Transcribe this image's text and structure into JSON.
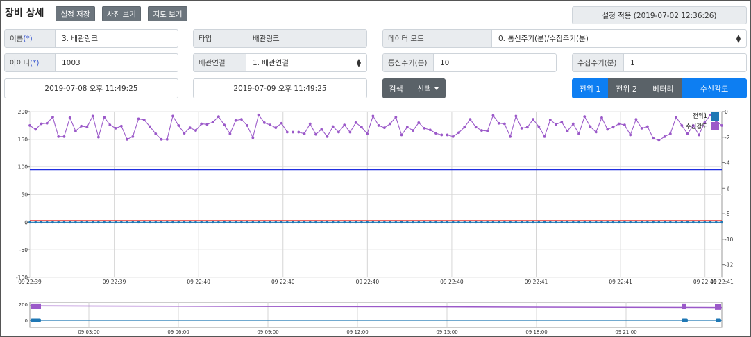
{
  "header": {
    "title": "장비 상세",
    "save_label": "설정 저장",
    "photo_label": "사진 보기",
    "map_label": "지도 보기",
    "apply_label": "설정 적용 (2019-07-02 12:36:26)"
  },
  "form": {
    "name_label": "이름",
    "name_required": "(*)",
    "name_value": "3. 배관링크",
    "type_label": "타입",
    "type_value": "배관링크",
    "mode_label": "데이터 모드",
    "mode_value": "0. 통신주기(분)/수집주기(분)",
    "id_label": "아이디",
    "id_required": "(*)",
    "id_value": "1003",
    "link_label": "배관연결",
    "link_value": "1. 배관연결",
    "comm_label": "통신주기(분)",
    "comm_value": "10",
    "collect_label": "수집주기(분)",
    "collect_value": "1",
    "date_from": "2019-07-08 오후 11:49:25",
    "date_to": "2019-07-09 오후 11:49:25",
    "search_label": "검색",
    "select_label": "선택"
  },
  "toggles": {
    "v1": "전위 1",
    "v2": "전위 2",
    "battery": "베터리",
    "rssi": "수신감도"
  },
  "colors": {
    "purple": "#9b59c9",
    "blue_line": "#1f2de0",
    "red_line": "#e8322b",
    "dot_blue": "#1f77b4",
    "legend_blue": "#1f77b4",
    "legend_purple": "#9b59c9"
  },
  "chart_data": {
    "type": "line",
    "main": {
      "left_ticks": [
        "200",
        "150",
        "100",
        "50",
        "0",
        "-50",
        "-100"
      ],
      "right_ticks": [
        "0",
        "-2",
        "-4",
        "-6",
        "-8",
        "-10",
        "-12"
      ],
      "x_ticks": [
        "09 22:39",
        "09 22:39",
        "09 22:40",
        "09 22:40",
        "09 22:40",
        "09 22:40",
        "09 22:41",
        "09 22:41",
        "09 22:41"
      ],
      "ylim_left": [
        -100,
        200
      ],
      "ylim_right": [
        -13,
        0
      ],
      "legend": [
        "전위1",
        "수신감도"
      ],
      "series": [
        {
          "name": "수신감도",
          "axis": "left",
          "values": [
            175,
            168,
            178,
            179,
            190,
            155,
            155,
            189,
            165,
            174,
            172,
            192,
            154,
            190,
            176,
            170,
            174,
            150,
            155,
            187,
            185,
            173,
            160,
            150,
            150,
            192,
            175,
            161,
            171,
            166,
            178,
            177,
            181,
            191,
            176,
            160,
            184,
            186,
            175,
            153,
            194,
            180,
            176,
            171,
            179,
            163,
            163,
            163,
            160,
            178,
            159,
            168,
            155,
            173,
            163,
            176,
            163,
            180,
            172,
            160,
            192,
            175,
            171,
            178,
            190,
            158,
            172,
            166,
            180,
            170,
            167,
            161,
            158,
            158,
            155,
            162,
            172,
            186,
            172,
            166,
            165,
            193,
            179,
            178,
            155,
            192,
            170,
            172,
            186,
            173,
            155,
            185,
            177,
            181,
            165,
            178,
            160,
            191,
            173,
            163,
            189,
            168,
            172,
            178,
            176,
            158,
            186,
            170,
            173,
            152,
            148,
            155,
            160,
            190,
            175,
            160,
            175,
            158,
            180,
            194,
            183,
            175
          ]
        },
        {
          "name": "전위1",
          "axis": "left",
          "constant": 0
        }
      ],
      "threshold_lines": [
        95,
        3
      ]
    },
    "overview": {
      "left_ticks": [
        "200",
        "0"
      ],
      "x_ticks": [
        "09 03:00",
        "09 06:00",
        "09 09:00",
        "09 12:00",
        "09 15:00",
        "09 18:00",
        "09 21:00"
      ]
    }
  }
}
